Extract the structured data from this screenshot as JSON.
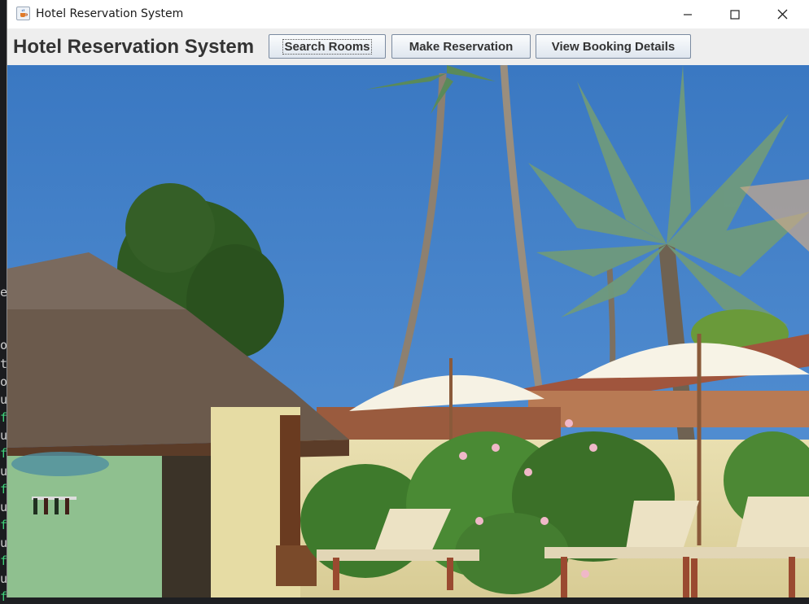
{
  "window": {
    "title": "Hotel Reservation System",
    "controls": [
      "minimize-icon",
      "maximize-icon",
      "close-icon"
    ]
  },
  "toolbar": {
    "heading": "Hotel Reservation System",
    "buttons": [
      {
        "label": "Search Rooms",
        "focused": true
      },
      {
        "label": "Make Reservation",
        "focused": false
      },
      {
        "label": "View Booking Details",
        "focused": false
      }
    ]
  },
  "hero": {
    "image": "resort-pool-photo",
    "colors": {
      "sky": "#3f7fc6",
      "roof": "#6b5a4c",
      "wall": "#e4d9a6",
      "foliage": "#3e7a2c",
      "umbrella": "#f6f2e4"
    }
  },
  "background_terminal": {
    "glyphs": [
      "e",
      "o",
      "t",
      "o",
      "u",
      "f",
      "u",
      "f",
      "u",
      "f",
      "u",
      "f",
      "u",
      "f",
      "u",
      "f"
    ]
  }
}
